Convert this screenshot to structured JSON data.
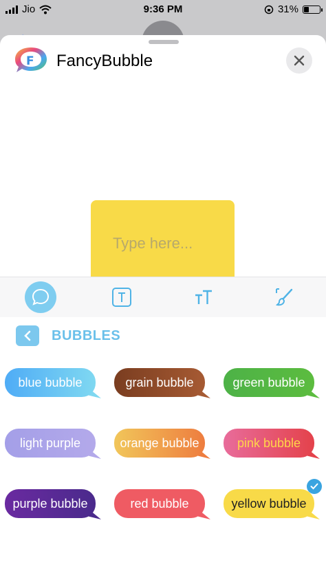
{
  "status_bar": {
    "carrier": "Jio",
    "time": "9:36 PM",
    "battery": "31%",
    "battery_level": 0.31
  },
  "app": {
    "title": "FancyBubble"
  },
  "preview": {
    "placeholder": "Type here...",
    "color": "#f8da48"
  },
  "toolbar": {
    "tools": [
      "bubble-style",
      "text",
      "font-size",
      "brush"
    ],
    "active": "bubble-style"
  },
  "section": {
    "title": "BUBBLES"
  },
  "bubbles": [
    {
      "label": "blue bubble",
      "colors": [
        "#4facf6",
        "#7fd8f1"
      ],
      "text_color": "#ffffff"
    },
    {
      "label": "grain bubble",
      "colors": [
        "#7a3d20",
        "#a65a33"
      ],
      "text_color": "#ffffff"
    },
    {
      "label": "green bubble",
      "colors": [
        "#4db247",
        "#5cbc3f"
      ],
      "text_color": "#ffffff"
    },
    {
      "label": "light purple",
      "colors": [
        "#a49fe8",
        "#b3a9ea"
      ],
      "text_color": "#ffffff"
    },
    {
      "label": "orange bubble",
      "colors": [
        "#f1c65a",
        "#ee7d3f"
      ],
      "text_color": "#ffffff"
    },
    {
      "label": "pink bubble",
      "colors": [
        "#e86c9b",
        "#e4424b"
      ],
      "text_color": "#ffd54a"
    },
    {
      "label": "purple bubble",
      "colors": [
        "#6a2aa0",
        "#4a2a8c"
      ],
      "text_color": "#ffffff"
    },
    {
      "label": "red bubble",
      "colors": [
        "#ef5b63",
        "#ef5b63"
      ],
      "text_color": "#ffffff"
    },
    {
      "label": "yellow bubble",
      "colors": [
        "#f8da48",
        "#f8da48"
      ],
      "text_color": "#222222",
      "selected": true
    }
  ]
}
